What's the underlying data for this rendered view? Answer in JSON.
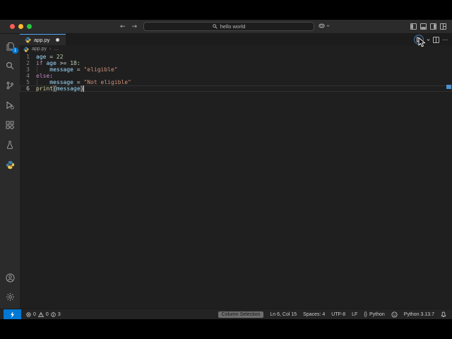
{
  "title_bar": {
    "search_text": "hello world",
    "back_glyph": "←",
    "forward_glyph": "→",
    "more_glyph": "⋯"
  },
  "activity_bar": {
    "explorer_badge": "1",
    "items": [
      "explorer",
      "search",
      "source-control",
      "run-and-debug",
      "extensions",
      "testing",
      "python"
    ],
    "bottom_items": [
      "accounts",
      "settings"
    ]
  },
  "tab": {
    "name": "app.py"
  },
  "breadcrumb": {
    "file": "app.py",
    "separator": "›",
    "tail": "…"
  },
  "editor": {
    "lines": [
      {
        "num": "1",
        "tokens": [
          {
            "t": "age",
            "c": "var"
          },
          {
            "t": " = ",
            "c": "plain"
          },
          {
            "t": "22",
            "c": "num"
          }
        ]
      },
      {
        "num": "2",
        "tokens": [
          {
            "t": "if",
            "c": "kw"
          },
          {
            "t": " ",
            "c": "plain"
          },
          {
            "t": "age",
            "c": "var"
          },
          {
            "t": " >= ",
            "c": "plain"
          },
          {
            "t": "18",
            "c": "num"
          },
          {
            "t": ":",
            "c": "plain"
          }
        ]
      },
      {
        "num": "3",
        "indent_guide": true,
        "tokens": [
          {
            "t": "    ",
            "c": "plain"
          },
          {
            "t": "message",
            "c": "var"
          },
          {
            "t": " = ",
            "c": "plain"
          },
          {
            "t": "\"eligible\"",
            "c": "str"
          }
        ]
      },
      {
        "num": "4",
        "tokens": [
          {
            "t": "else",
            "c": "kw"
          },
          {
            "t": ":",
            "c": "plain"
          }
        ]
      },
      {
        "num": "5",
        "indent_guide": true,
        "tokens": [
          {
            "t": "    ",
            "c": "plain"
          },
          {
            "t": "message",
            "c": "var"
          },
          {
            "t": " = ",
            "c": "plain"
          },
          {
            "t": "\"Not eligible\"",
            "c": "str"
          }
        ]
      },
      {
        "num": "6",
        "current": true,
        "cursor": true,
        "tokens": [
          {
            "t": "print",
            "c": "fn"
          },
          {
            "t": "(",
            "c": "bracket"
          },
          {
            "t": "message",
            "c": "var"
          },
          {
            "t": ")",
            "c": "bracket"
          }
        ]
      }
    ]
  },
  "status_bar": {
    "problems": {
      "errors": "0",
      "warnings": "0",
      "infos": "3"
    },
    "column_selection": "Column Selection",
    "cursor_position": "Ln 6, Col 15",
    "indentation": "Spaces: 4",
    "encoding": "UTF-8",
    "eol": "LF",
    "language_prefix": "{}",
    "language": "Python",
    "interpreter": "Python 3.13.7"
  },
  "colors": {
    "accent": "#0078d4",
    "tab_indicator": "#52aeff",
    "editor_bg": "#1f1f1f",
    "chrome_bg": "#2b2b2b",
    "variable": "#9cdcfe",
    "number": "#b5cea8",
    "keyword": "#c586c0",
    "string": "#ce9178",
    "function": "#dcdcaa"
  }
}
